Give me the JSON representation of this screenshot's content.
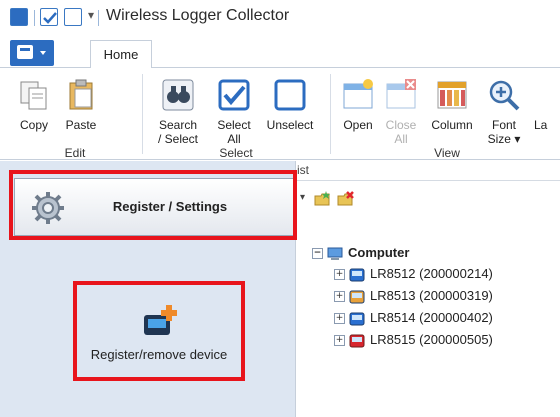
{
  "window": {
    "title": "Wireless Logger Collector"
  },
  "tabs": {
    "home": "Home"
  },
  "ribbon": {
    "edit": {
      "copy": "Copy",
      "paste": "Paste",
      "group": "Edit"
    },
    "select": {
      "search_line1": "Search",
      "search_line2": "/ Select",
      "select_all_line1": "Select",
      "select_all_line2": "All",
      "unselect": "Unselect",
      "group": "Select"
    },
    "view": {
      "open": "Open",
      "close_line1": "Close",
      "close_line2": "All",
      "column": "Column",
      "font_line1": "Font",
      "font_line2": "Size ▾",
      "cut_label": "La",
      "group": "View"
    }
  },
  "left": {
    "register_settings": "Register / Settings",
    "register_device": "Register/remove device"
  },
  "right": {
    "list_header": "ist",
    "root": "Computer",
    "devices": [
      {
        "label": "LR8512 (200000214)",
        "color": "#2a6fd0"
      },
      {
        "label": "LR8513 (200000319)",
        "color": "#2a6fd0"
      },
      {
        "label": "LR8514 (200000402)",
        "color": "#2a6fd0"
      },
      {
        "label": "LR8515 (200000505)",
        "color": "#d7262e"
      }
    ]
  },
  "colors": {
    "highlight_box": "#e8141c",
    "accent": "#2c6cc0"
  }
}
